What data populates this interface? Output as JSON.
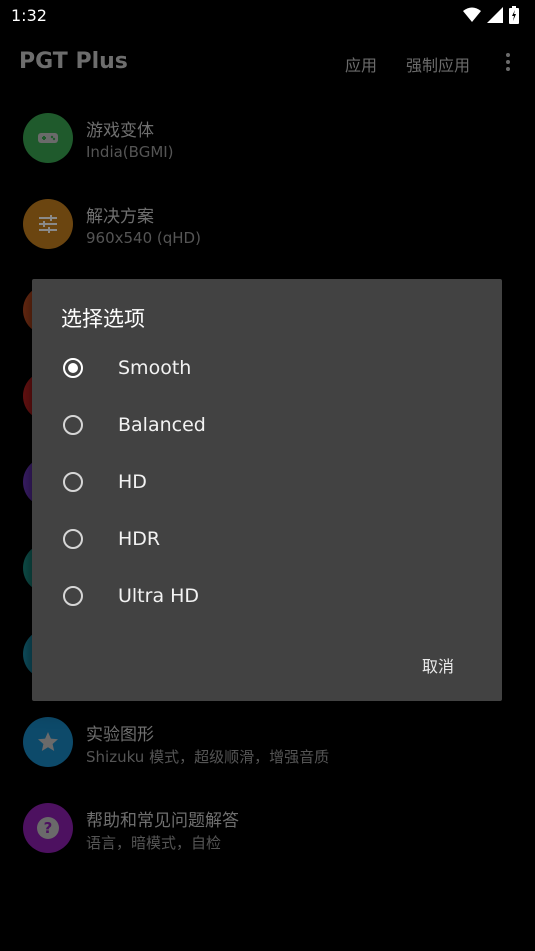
{
  "status_bar": {
    "time": "1:32"
  },
  "app_bar": {
    "title": "PGT Plus",
    "apply_label": "应用",
    "force_apply_label": "强制应用"
  },
  "list_items": [
    {
      "title": "游戏变体",
      "subtitle": "India(BGMI)",
      "color": "#1f5a2c"
    },
    {
      "title": "解决方案",
      "subtitle": "960x540 (qHD)",
      "color": "#6b4510"
    },
    {
      "title": "",
      "subtitle": "",
      "color": "#6a2a12"
    },
    {
      "title": "",
      "subtitle": "",
      "color": "#6a1212"
    },
    {
      "title": "",
      "subtitle": "",
      "color": "#3b1e6a"
    },
    {
      "title": "",
      "subtitle": "",
      "color": "#0e4f4a"
    },
    {
      "title": "",
      "subtitle": "",
      "color": "#0e4f5f"
    },
    {
      "title": "实验图形",
      "subtitle": "Shizuku 模式，超级顺滑，增强音质",
      "color": "#0d4a6a"
    },
    {
      "title": "帮助和常见问题解答",
      "subtitle": "语言，暗模式，自检",
      "color": "#4d1160"
    }
  ],
  "dialog": {
    "title": "选择选项",
    "options": [
      {
        "label": "Smooth",
        "selected": true
      },
      {
        "label": "Balanced",
        "selected": false
      },
      {
        "label": "HD",
        "selected": false
      },
      {
        "label": "HDR",
        "selected": false
      },
      {
        "label": "Ultra HD",
        "selected": false
      }
    ],
    "cancel_label": "取消"
  }
}
